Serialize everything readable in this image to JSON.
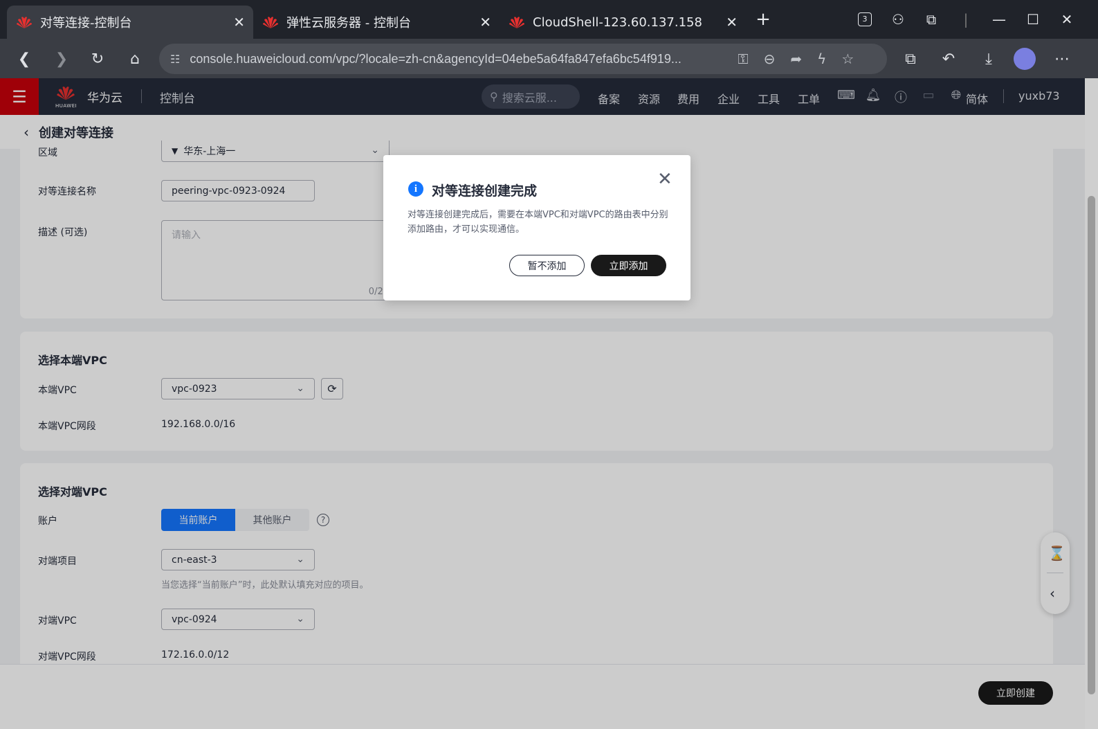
{
  "browser": {
    "tabs": [
      {
        "title": "对等连接-控制台",
        "active": true
      },
      {
        "title": "弹性云服务器 - 控制台",
        "active": false
      },
      {
        "title": "CloudShell-123.60.137.158",
        "active": false
      }
    ],
    "new_tab": "+",
    "tab_count": "3",
    "url": "console.huaweicloud.com/vpc/?locale=zh-cn&agencyId=04ebe5a64fa847efa6bc54f919...",
    "colors": {
      "tab_bg": "#20232a",
      "toolbar_bg": "#3a3d44",
      "brand_red": "#c7000b"
    }
  },
  "console_header": {
    "brand_sub": "HUAWEI",
    "brand": "华为云",
    "title": "控制台",
    "search_placeholder": "搜索云服...",
    "nav": [
      "备案",
      "资源",
      "费用",
      "企业",
      "工具",
      "工单"
    ],
    "language": "简体",
    "user": "yuxb73"
  },
  "page": {
    "title": "创建对等连接"
  },
  "basic": {
    "region_label": "区域",
    "region_value": "华东-上海一",
    "name_label": "对等连接名称",
    "name_value": "peering-vpc-0923-0924",
    "desc_label": "描述 (可选)",
    "desc_placeholder": "请输入",
    "desc_count": "0/25"
  },
  "local_vpc": {
    "section_title": "选择本端VPC",
    "vpc_label": "本端VPC",
    "vpc_value": "vpc-0923",
    "cidr_label": "本端VPC网段",
    "cidr_value": "192.168.0.0/16"
  },
  "peer_vpc": {
    "section_title": "选择对端VPC",
    "account_label": "账户",
    "account_options": [
      "当前账户",
      "其他账户"
    ],
    "account_selected": "当前账户",
    "project_label": "对端项目",
    "project_value": "cn-east-3",
    "project_hint": "当您选择“当前账户”时，此处默认填充对应的项目。",
    "vpc_label": "对端VPC",
    "vpc_value": "vpc-0924",
    "cidr_label": "对端VPC网段",
    "cidr_value": "172.16.0.0/12"
  },
  "footer": {
    "create_button": "立即创建"
  },
  "dialog": {
    "title": "对等连接创建完成",
    "message": "对等连接创建完成后，需要在本端VPC和对端VPC的路由表中分别添加路由，才可以实现通信。",
    "skip_button": "暂不添加",
    "add_button": "立即添加",
    "accent_color": "#1476ff"
  }
}
